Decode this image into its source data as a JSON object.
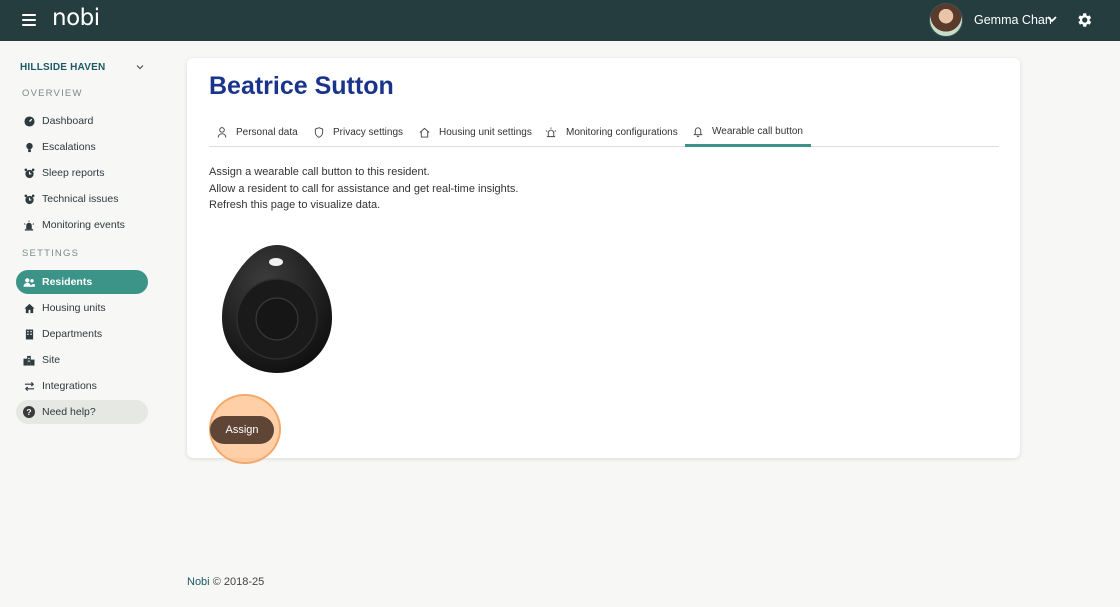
{
  "topbar": {
    "logo": "nobi",
    "user_name": "Gemma Chan"
  },
  "sidebar": {
    "site_name": "HILLSIDE HAVEN",
    "overview_label": "OVERVIEW",
    "settings_label": "SETTINGS",
    "overview_items": [
      {
        "label": "Dashboard",
        "icon": "gauge-icon"
      },
      {
        "label": "Escalations",
        "icon": "lightbulb-icon"
      },
      {
        "label": "Sleep reports",
        "icon": "alarm-clock-icon"
      },
      {
        "label": "Technical issues",
        "icon": "alarm-clock-icon"
      },
      {
        "label": "Monitoring events",
        "icon": "siren-icon"
      }
    ],
    "settings_items": [
      {
        "label": "Residents",
        "icon": "users-icon",
        "active": true
      },
      {
        "label": "Housing units",
        "icon": "house-icon"
      },
      {
        "label": "Departments",
        "icon": "building-icon"
      },
      {
        "label": "Site",
        "icon": "city-icon"
      },
      {
        "label": "Integrations",
        "icon": "arrows-icon"
      }
    ],
    "help_label": "Need help?"
  },
  "resident": {
    "name": "Beatrice Sutton",
    "tabs": [
      {
        "label": "Personal data",
        "icon": "person-icon"
      },
      {
        "label": "Privacy settings",
        "icon": "shield-icon"
      },
      {
        "label": "Housing unit settings",
        "icon": "house-icon"
      },
      {
        "label": "Monitoring configurations",
        "icon": "siren-icon"
      },
      {
        "label": "Wearable call button",
        "icon": "bell-icon",
        "active": true
      }
    ],
    "description": [
      "Assign a wearable call button to this resident.",
      "Allow a resident to call for assistance and get real-time insights.",
      "Refresh this page to visualize data."
    ],
    "assign_label": "Assign"
  },
  "footer": {
    "brand": "Nobi",
    "copyright": "© 2018-25"
  },
  "colors": {
    "topbar": "#253d3f",
    "accent": "#3c9489",
    "title": "#19348a",
    "assign": "#5e4535",
    "highlight": "#f4a86a"
  }
}
